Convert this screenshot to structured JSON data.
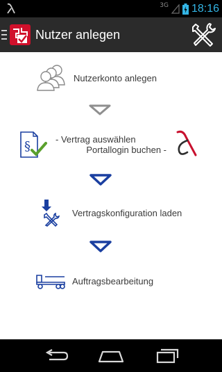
{
  "status_bar": {
    "network": "3G",
    "time": "18:16"
  },
  "action_bar": {
    "title": "Nutzer anlegen"
  },
  "steps": {
    "create_account": "Nutzerkonto anlegen",
    "select_contract": "- Vertrag auswählen",
    "book_portal_login": "Portallogin buchen -",
    "load_config": "Vertragskonfiguration laden",
    "order_processing": "Auftragsbearbeitung"
  },
  "colors": {
    "accent": "#33b5e5",
    "arrow_grey": "#8f8f8f",
    "arrow_blue": "#1a3fa0",
    "brand_red": "#c8102e"
  }
}
